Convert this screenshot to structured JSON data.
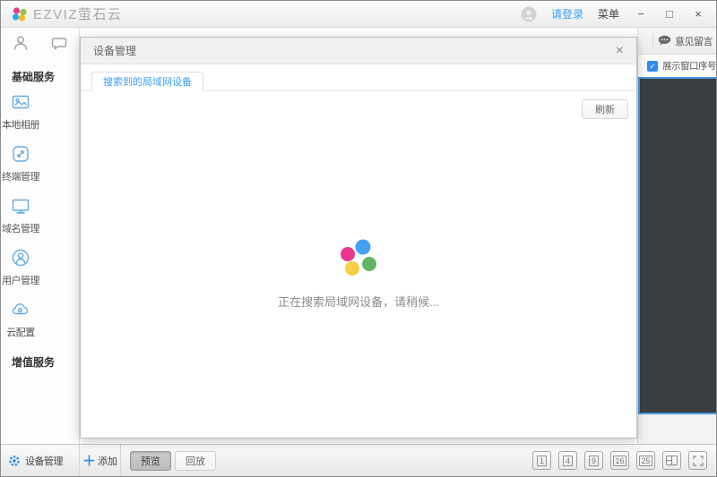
{
  "titlebar": {
    "logo_text": "EZVIZ萤石云",
    "login_label": "请登录",
    "menu_label": "菜单"
  },
  "icons": {
    "minimize": "−",
    "maximize": "□",
    "close": "×",
    "dialog_close": "×",
    "plus": "＋",
    "check": "✓"
  },
  "sidebar": {
    "basic_section": "基础服务",
    "value_section": "增值服务",
    "items": [
      {
        "label": "本地相册",
        "icon": "photo-icon"
      },
      {
        "label": "终端管理",
        "icon": "terminal-icon"
      },
      {
        "label": "域名管理",
        "icon": "domain-icon"
      },
      {
        "label": "用户管理",
        "icon": "user-icon"
      },
      {
        "label": "云配置",
        "icon": "cloud-config-icon"
      }
    ]
  },
  "dialog": {
    "title": "设备管理",
    "tab_label": "搜索到的局域网设备",
    "refresh_label": "刷新",
    "loading_text": "正在搜索局域网设备，请稍候..."
  },
  "right_panel": {
    "feedback_label": "意见留言",
    "window_number_label": "展示窗口序号",
    "window_number_checked": true
  },
  "bottom_bar": {
    "device_label": "设备管理",
    "add_label": "添加",
    "preview_label": "预览",
    "playback_label": "回放",
    "grid_options": [
      "1",
      "4",
      "9",
      "16",
      "25"
    ]
  },
  "colors": {
    "accent_blue": "#2d8cf0",
    "link_blue": "#3a9ef5",
    "icon_blue": "#64ace4",
    "spinner_pink": "#e8368f",
    "spinner_blue": "#45a1f5",
    "spinner_green": "#5fb564",
    "spinner_yellow": "#f7ce46",
    "panel_dark": "#3a3e43",
    "selection_blue": "#4a97e0"
  }
}
